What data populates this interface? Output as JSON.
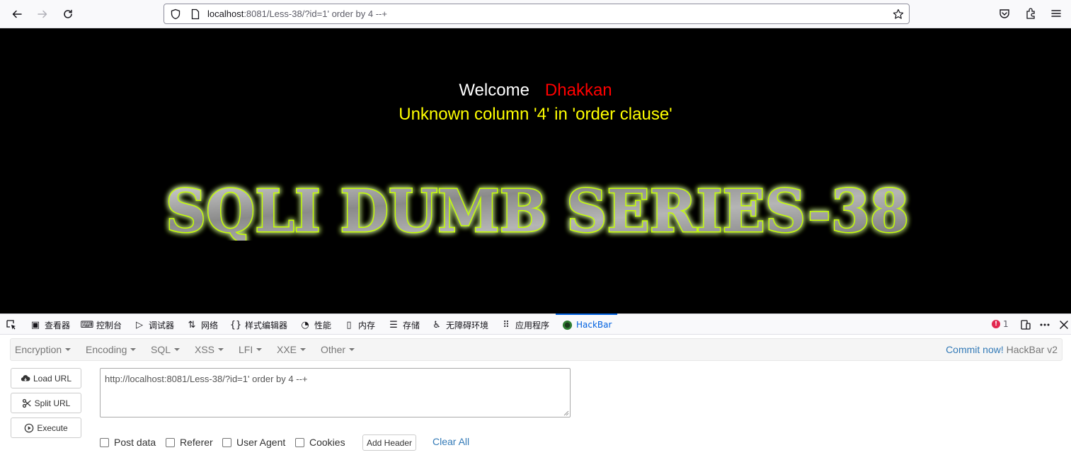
{
  "browser": {
    "url_host": "localhost",
    "url_rest": ":8081/Less-38/?id=1' order by 4 --+"
  },
  "page": {
    "welcome_word": "Welcome",
    "welcome_name": "Dhakkan",
    "error_message": "Unknown column '4' in 'order clause'",
    "banner_text": "SQLI DUMB SERIES-38",
    "colors": {
      "background": "#000000",
      "welcome": "#ffffff",
      "name": "#ff0000",
      "error": "#ffff00",
      "banner_glow": "#c6ff00"
    }
  },
  "devtools": {
    "tabs": [
      {
        "label": "查看器",
        "icon": "inspector-icon"
      },
      {
        "label": "控制台",
        "icon": "console-icon"
      },
      {
        "label": "调试器",
        "icon": "debugger-icon"
      },
      {
        "label": "网络",
        "icon": "network-icon"
      },
      {
        "label": "样式编辑器",
        "icon": "style-editor-icon"
      },
      {
        "label": "性能",
        "icon": "performance-icon"
      },
      {
        "label": "内存",
        "icon": "memory-icon"
      },
      {
        "label": "存储",
        "icon": "storage-icon"
      },
      {
        "label": "无障碍环境",
        "icon": "accessibility-icon"
      },
      {
        "label": "应用程序",
        "icon": "application-icon"
      },
      {
        "label": "HackBar",
        "icon": "hackbar-icon",
        "active": true
      }
    ],
    "error_count": "1"
  },
  "hackbar": {
    "menu": [
      "Encryption",
      "Encoding",
      "SQL",
      "XSS",
      "LFI",
      "XXE",
      "Other"
    ],
    "commit_link": "Commit now!",
    "version": "HackBar v2",
    "buttons": {
      "load_url": "Load URL",
      "split_url": "Split URL",
      "execute": "Execute"
    },
    "url_value": "http://localhost:8081/Less-38/?id=1' order by 4 --+",
    "options": {
      "post_data": "Post data",
      "referer": "Referer",
      "user_agent": "User Agent",
      "cookies": "Cookies"
    },
    "add_header": "Add Header",
    "clear_all": "Clear All"
  }
}
